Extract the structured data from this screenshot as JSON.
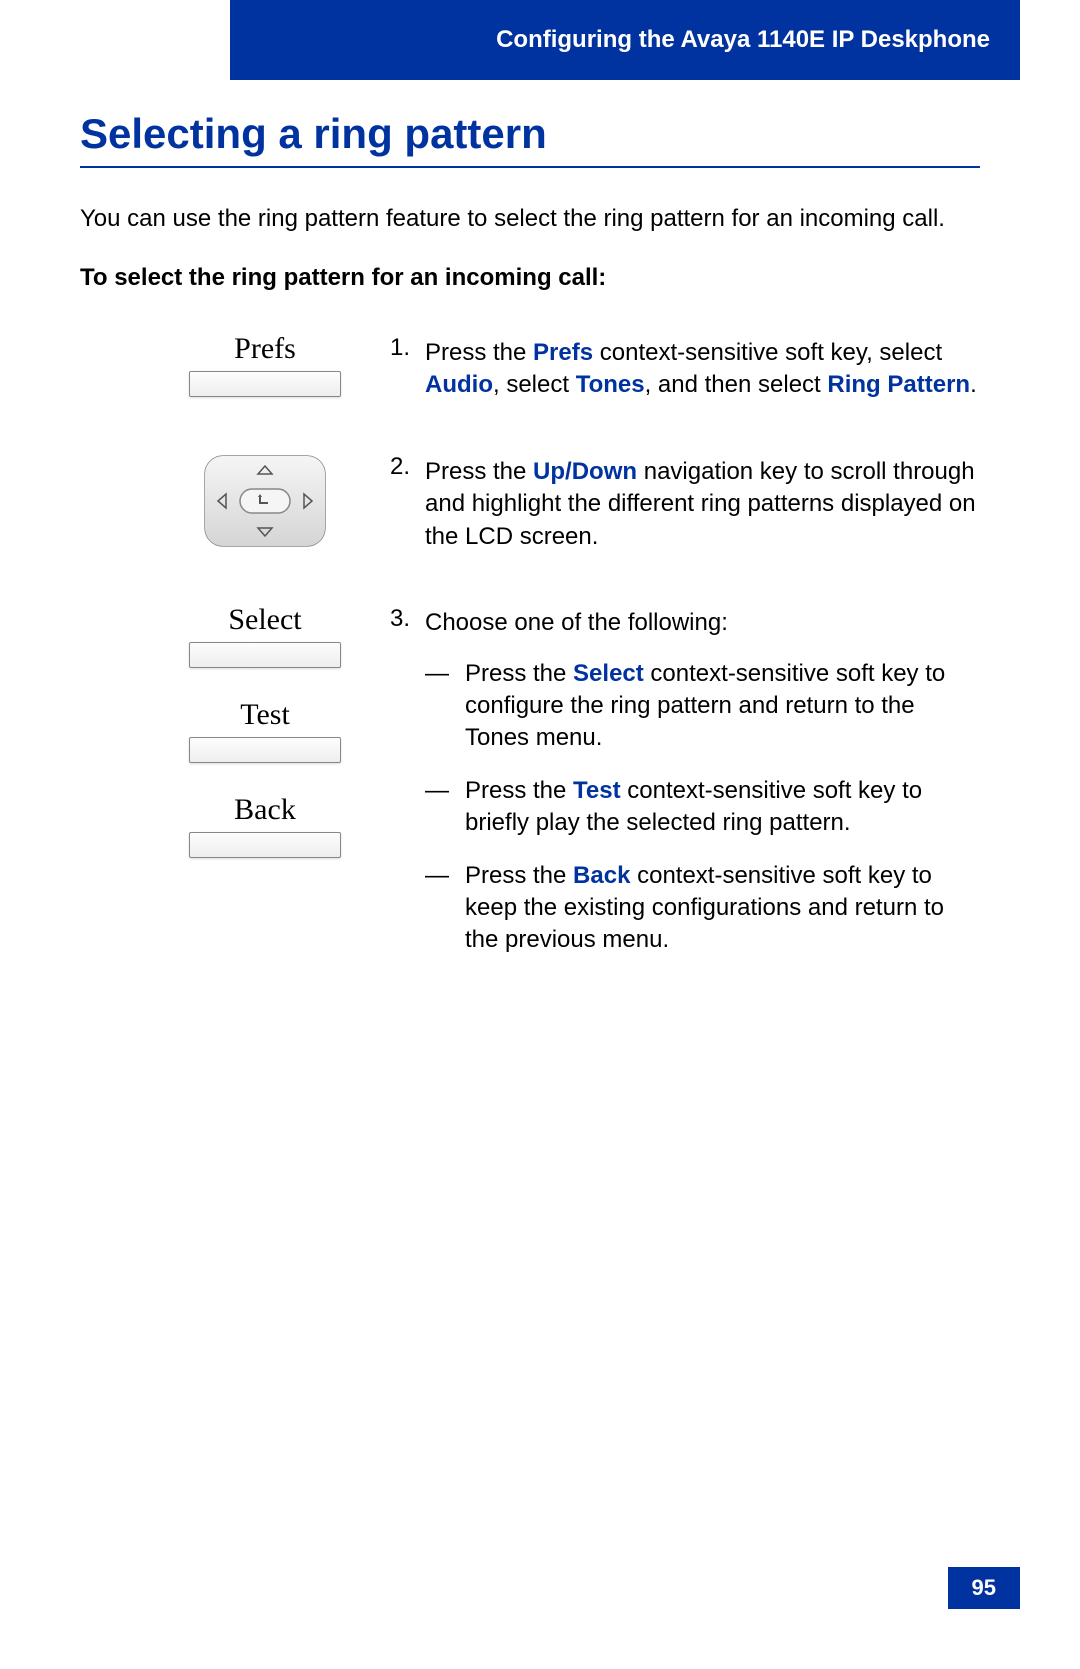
{
  "header": {
    "chapter": "Configuring the Avaya 1140E IP Deskphone"
  },
  "section": {
    "title": "Selecting a ring pattern",
    "intro": "You can use the ring pattern feature to select the ring pattern for an incoming call.",
    "subhead": "To select the ring pattern for an incoming call:"
  },
  "softkeys": {
    "prefs": "Prefs",
    "select": "Select",
    "test": "Test",
    "back": "Back"
  },
  "steps": {
    "s1": {
      "num": "1.",
      "pre": "Press the ",
      "k1": "Prefs",
      "mid1": " context-sensitive soft key, select ",
      "k2": "Audio",
      "mid2": ", select ",
      "k3": "Tones",
      "mid3": ", and then select ",
      "k4": "Ring Pattern",
      "end": "."
    },
    "s2": {
      "num": "2.",
      "pre": "Press the ",
      "k1": "Up",
      "slash": "/",
      "k2": "Down",
      "post": " navigation key to scroll through and highlight the different ring patterns displayed on the LCD screen."
    },
    "s3": {
      "num": "3.",
      "lead": "Choose one of the following:",
      "a_pre": "Press the ",
      "a_k": "Select",
      "a_post": " context-sensitive soft key to configure the ring pattern and return to the Tones menu.",
      "b_pre": "Press the ",
      "b_k": "Test",
      "b_post": " context-sensitive soft key to briefly play the selected ring pattern.",
      "c_pre": "Press the ",
      "c_k": "Back",
      "c_post": " context-sensitive soft key to keep the existing configurations and return to the previous menu."
    }
  },
  "page_number": "95"
}
